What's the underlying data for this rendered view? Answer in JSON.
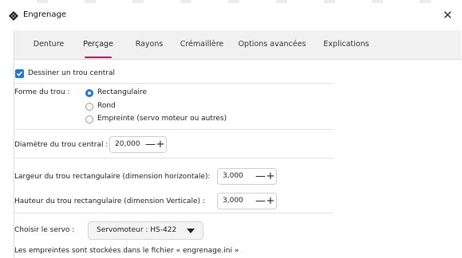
{
  "window": {
    "title": "Engrenage",
    "close_glyph": "✕",
    "icon": "gear-app-icon"
  },
  "tabs": [
    {
      "label": "Denture",
      "active": false
    },
    {
      "label": "Perçage",
      "active": true
    },
    {
      "label": "Rayons",
      "active": false
    },
    {
      "label": "Crémaillère",
      "active": false
    },
    {
      "label": "Options avancées",
      "active": false
    },
    {
      "label": "Explications",
      "active": false
    }
  ],
  "form": {
    "draw_hole": {
      "label": "Dessiner un trou central",
      "checked": true
    },
    "hole_shape": {
      "label": "Forme du trou :",
      "options": [
        {
          "label": "Rectangulaire",
          "selected": true
        },
        {
          "label": "Rond",
          "selected": false
        },
        {
          "label": "Empreinte (servo moteur ou autres)",
          "selected": false
        }
      ]
    },
    "diameter": {
      "label": "Diamètre du trou central :",
      "value": "20,000"
    },
    "width": {
      "label": "Largeur du trou rectangulaire (dimension horizontale):",
      "value": "3,000"
    },
    "height": {
      "label": "Hauteur du trou rectangulaire (dimension Verticale) :",
      "value": "3,000"
    },
    "servo": {
      "label": "Choisir le servo :",
      "value": "Servomoteur : HS-422"
    },
    "note": "Les empreintes sont stockées dans le fichier « engrenage.ini »"
  },
  "spin_glyphs": {
    "minus": "—",
    "plus": "+"
  },
  "colors": {
    "accent": "#1f78d1",
    "tab_underline": "#c2185b",
    "tab_bg": "#f1f1f1"
  }
}
